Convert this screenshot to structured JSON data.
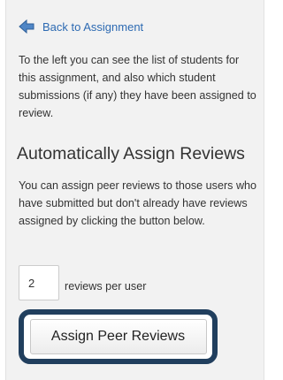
{
  "back_link": {
    "label": "Back to Assignment",
    "icon": "arrow-left-icon"
  },
  "intro_text": "To the left you can see the list of students for this assignment, and also which student submissions (if any) they have been assigned to review.",
  "section": {
    "title": "Automatically Assign Reviews",
    "description": "You can assign peer reviews to those users who have submitted but don't already have reviews assigned by clicking the button below."
  },
  "reviews_per_user": {
    "value": "2",
    "label": "reviews per user"
  },
  "assign_button": {
    "label": "Assign Peer Reviews"
  },
  "colors": {
    "link": "#2d6ab2",
    "highlight_border": "#213f5e",
    "panel_background": "#f2f2f2"
  }
}
